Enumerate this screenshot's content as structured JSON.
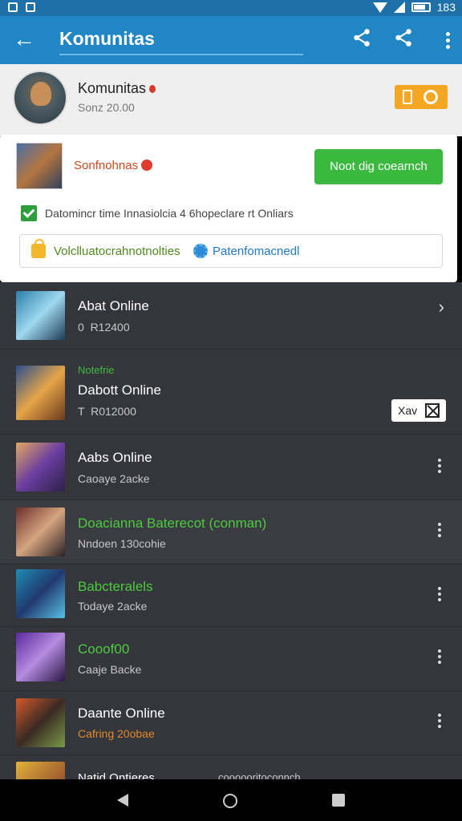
{
  "status_bar": {
    "time": "183"
  },
  "app_bar": {
    "title": "Komunitas"
  },
  "profile": {
    "name": "Komunitas",
    "subtitle": "Sonz 20.00"
  },
  "card": {
    "name": "Sonfnohnas",
    "primary_button": "Noot dig coearnch",
    "checkbox_label": "Datomincr time Innasiolcia 4 6hopeclare rt Onliars",
    "info_left": "Volclluatocrahnotnolties",
    "info_right": "Patenfomacnedl"
  },
  "list": {
    "items": [
      {
        "name": "Abat Online",
        "sub": "0  R12400",
        "tag": "",
        "action": "chevron"
      },
      {
        "name": "Dabott Online",
        "sub": "T  R012000",
        "tag": "Notefrie",
        "action": "badge",
        "badge": "Xav"
      },
      {
        "name": "Aabs Online",
        "sub": "Caoaye 2acke",
        "tag": "",
        "action": "more"
      },
      {
        "name": "Doacianna Baterecot (conman)",
        "sub": "Nndoen 130cohie",
        "tag": "",
        "action": "more"
      },
      {
        "name": "Babcteralels",
        "sub": "Todaye 2acke",
        "tag": "",
        "action": "more"
      },
      {
        "name": "Cooof00",
        "sub": "Caaje Backe",
        "tag": "",
        "action": "more"
      },
      {
        "name": "Daante Online",
        "sub": "Cafring 20obae",
        "tag": "",
        "action": "more"
      },
      {
        "name": "Natid Ontieres",
        "sub": "coooooritoconnch",
        "tag": "",
        "action": "more"
      }
    ]
  },
  "colors": {
    "appbar": "#2086c4",
    "list_bg": "#34363b",
    "primary_button": "#3bb93f",
    "accent_orange": "#f5a623"
  }
}
